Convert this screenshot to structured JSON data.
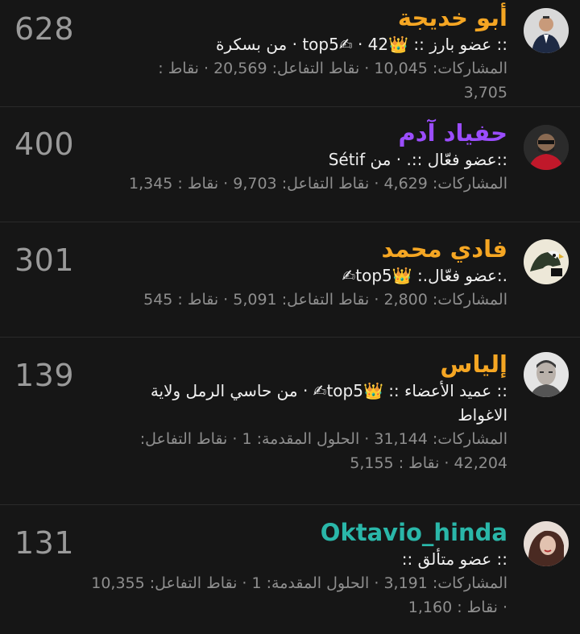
{
  "members": [
    {
      "name": "أبو خديجة",
      "name_color": "#f5a623",
      "score": "628",
      "meta": ":: عضو بارز :: 👑top5✍ · 42 · من بسكرة",
      "stats": "المشاركات: 10,045 · نقاط التفاعل: 20,569 · نقاط : 3,705"
    },
    {
      "name": "حفياد آدم",
      "name_color": "#9b4dff",
      "score": "400",
      "meta": "::عضو فعّال ::. · من Sétif",
      "stats": "المشاركات: 4,629 · نقاط التفاعل: 9,703 · نقاط : 1,345"
    },
    {
      "name": "فادي محمد",
      "name_color": "#f5a623",
      "score": "301",
      "meta": ".:عضو فعّال.: 👑top5✍",
      "stats": "المشاركات: 2,800 · نقاط التفاعل: 5,091 · نقاط : 545"
    },
    {
      "name": "إلياس",
      "name_color": "#f5a623",
      "score": "139",
      "meta": ":: عميد الأعضاء :: 👑top5✍ · من حاسي الرمل ولاية الاغواط",
      "stats": "المشاركات: 31,144 · الحلول المقدمة: 1 · نقاط التفاعل: 42,204 · نقاط : 5,155"
    },
    {
      "name": "Oktavio_hinda",
      "name_color": "#2ab7a9",
      "score": "131",
      "meta": ":: عضو متألق ::",
      "stats": "المشاركات: 3,191 · الحلول المقدمة: 1 · نقاط التفاعل: 10,355 · نقاط : 1,160"
    }
  ]
}
